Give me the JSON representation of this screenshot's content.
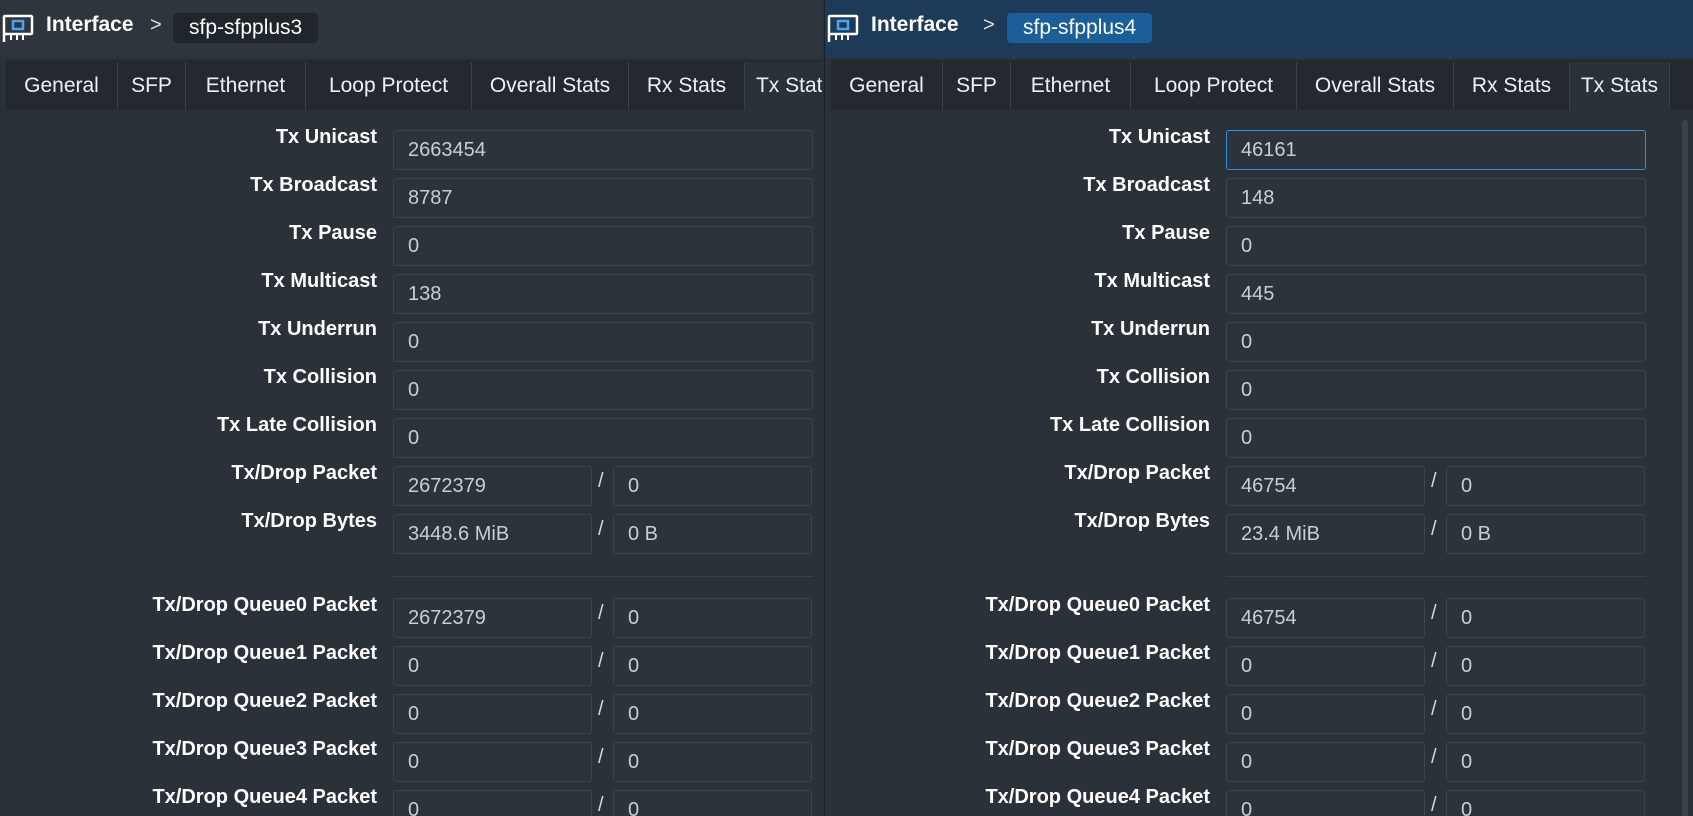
{
  "left": {
    "breadcrumb_root": "Interface",
    "breadcrumb_sep": ">",
    "breadcrumb_item": "sfp-sfpplus3",
    "tabs": [
      "General",
      "SFP",
      "Ethernet",
      "Loop Protect",
      "Overall Stats",
      "Rx Stats",
      "Tx Stats"
    ],
    "fields": {
      "tx_unicast": "2663454",
      "tx_broadcast": "8787",
      "tx_pause": "0",
      "tx_multicast": "138",
      "tx_underrun": "0",
      "tx_collision": "0",
      "tx_late_collision": "0",
      "tx_drop_packet": [
        "2672379",
        "0"
      ],
      "tx_drop_bytes": [
        "3448.6 MiB",
        "0 B"
      ],
      "q0": [
        "2672379",
        "0"
      ],
      "q1": [
        "0",
        "0"
      ],
      "q2": [
        "0",
        "0"
      ],
      "q3": [
        "0",
        "0"
      ],
      "q4": [
        "0",
        "0"
      ]
    }
  },
  "right": {
    "breadcrumb_root": "Interface",
    "breadcrumb_sep": ">",
    "breadcrumb_item": "sfp-sfpplus4",
    "tabs": [
      "General",
      "SFP",
      "Ethernet",
      "Loop Protect",
      "Overall Stats",
      "Rx Stats",
      "Tx Stats"
    ],
    "fields": {
      "tx_unicast": "46161",
      "tx_broadcast": "148",
      "tx_pause": "0",
      "tx_multicast": "445",
      "tx_underrun": "0",
      "tx_collision": "0",
      "tx_late_collision": "0",
      "tx_drop_packet": [
        "46754",
        "0"
      ],
      "tx_drop_bytes": [
        "23.4 MiB",
        "0 B"
      ],
      "q0": [
        "46754",
        "0"
      ],
      "q1": [
        "0",
        "0"
      ],
      "q2": [
        "0",
        "0"
      ],
      "q3": [
        "0",
        "0"
      ],
      "q4": [
        "0",
        "0"
      ]
    }
  },
  "labels": {
    "tx_unicast": "Tx Unicast",
    "tx_broadcast": "Tx Broadcast",
    "tx_pause": "Tx Pause",
    "tx_multicast": "Tx Multicast",
    "tx_underrun": "Tx Underrun",
    "tx_collision": "Tx Collision",
    "tx_late_collision": "Tx Late Collision",
    "tx_drop_packet": "Tx/Drop Packet",
    "tx_drop_bytes": "Tx/Drop Bytes",
    "q0": "Tx/Drop Queue0 Packet",
    "q1": "Tx/Drop Queue1 Packet",
    "q2": "Tx/Drop Queue2 Packet",
    "q3": "Tx/Drop Queue3 Packet",
    "q4": "Tx/Drop Queue4 Packet",
    "slash": "/"
  },
  "icons": {
    "interface": "network-card-icon"
  },
  "colors": {
    "accent": "#2d8ad9",
    "active_chip": "#1a5f99"
  }
}
